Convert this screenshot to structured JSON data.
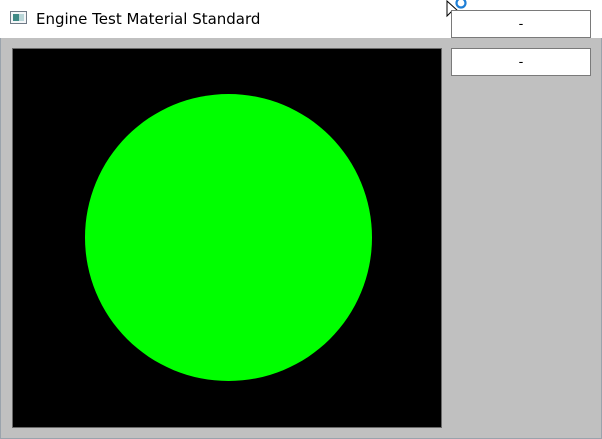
{
  "window": {
    "title": "Engine Test Material Standard"
  },
  "icons": {
    "app": "app-window-icon",
    "close": "close-icon",
    "cursor": "busy-cursor-icon"
  },
  "colors": {
    "viewport_bg": "#000000",
    "sphere": "#00ff00",
    "client_bg": "#c0c0c0"
  },
  "side_panel": {
    "buttons": [
      {
        "label": "-"
      },
      {
        "label": "-"
      }
    ]
  }
}
